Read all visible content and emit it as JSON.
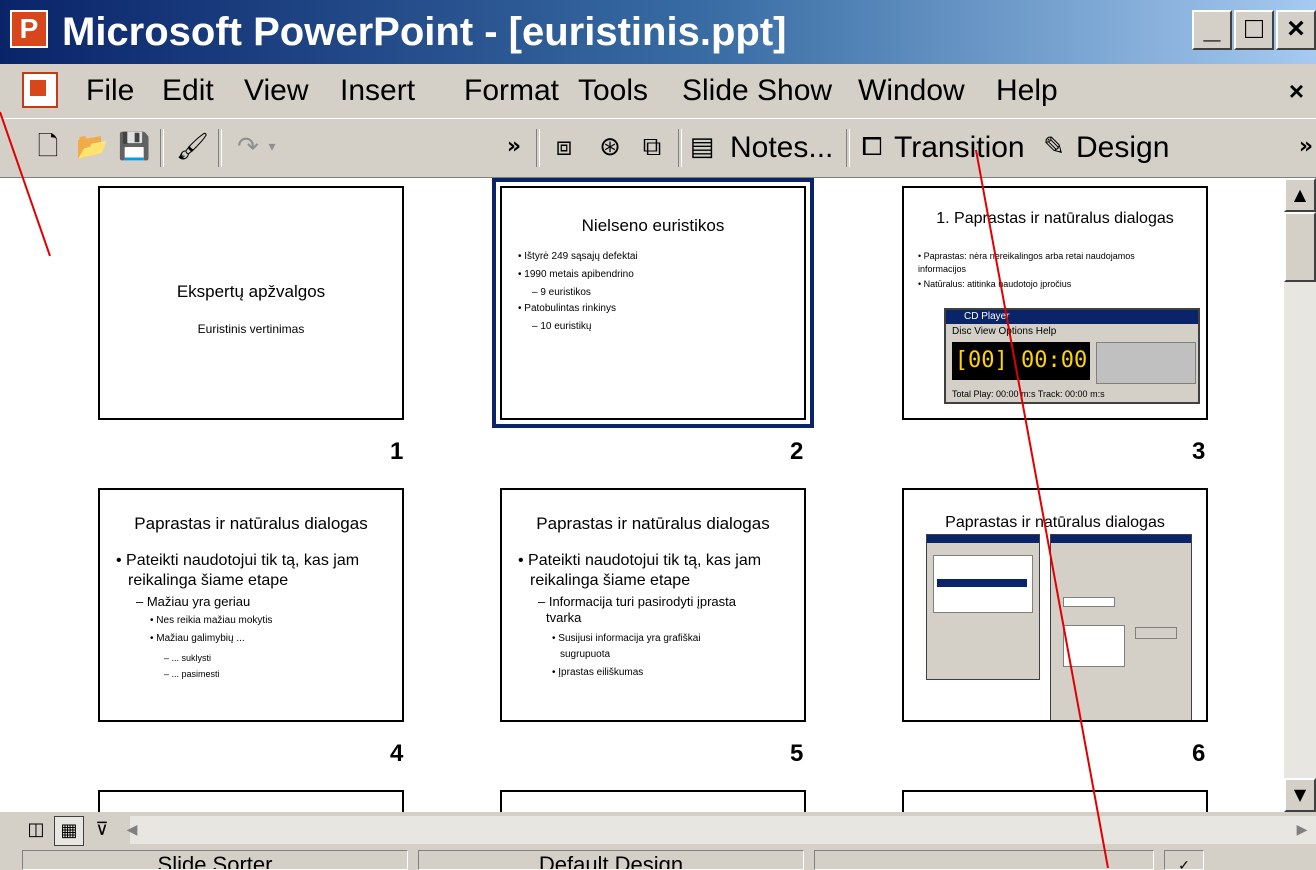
{
  "window": {
    "title": "Microsoft PowerPoint - [euristinis.ppt]",
    "minimize": "_",
    "maximize": "□",
    "close": "×"
  },
  "menu": {
    "items": [
      "File",
      "Edit",
      "View",
      "Insert",
      "Format",
      "Tools",
      "Slide Show",
      "Window",
      "Help"
    ],
    "close": "×"
  },
  "toolbar": {
    "notes_label": "Notes...",
    "transition_label": "Transition",
    "design_label": "Design",
    "chevron": "»"
  },
  "slides": [
    {
      "number": "1",
      "title": "Ekspertų apžvalgos",
      "subtitle": "Euristinis vertinimas"
    },
    {
      "number": "2",
      "title": "Nielseno euristikos",
      "bullets": [
        "Ištyrė 249 sąsajų defektai",
        "1990 metais apibendrino",
        "– 9 euristikos",
        "Patobulintas rinkinys",
        "– 10 euristikų"
      ]
    },
    {
      "number": "3",
      "title": "1. Paprastas ir natūralus dialogas",
      "bullets": [
        "Paprastas: nėra nereikalingos arba retai naudojamos informacijos",
        "Natūralus: atitinka naudotojo įpročius"
      ],
      "cd_player": {
        "title": "CD Player",
        "menu": "Disc  View  Options  Help",
        "display": "[00] 00:00",
        "status": "Total Play: 00:00 m:s       Track: 00:00 m:s"
      }
    },
    {
      "number": "4",
      "title": "Paprastas ir natūralus dialogas",
      "bullets": [
        "• Pateikti naudotojui tik tą, kas jam",
        "reikalinga šiame etape",
        "– Mažiau yra geriau",
        "• Nes reikia mažiau mokytis",
        "• Mažiau galimybių ...",
        "– ... suklysti",
        "– ... pasimesti"
      ]
    },
    {
      "number": "5",
      "title": "Paprastas ir natūralus dialogas",
      "bullets": [
        "• Pateikti naudotojui tik tą, kas jam",
        "reikalinga šiame etape",
        "– Informacija turi pasirodyti įprasta",
        "tvarka",
        "• Susijusi informacija yra grafiškai",
        "sugrupuota",
        "• Įprastas eiliškumas"
      ]
    },
    {
      "number": "6",
      "title": "Paprastas ir natūralus dialogas"
    }
  ],
  "statusbar": {
    "pane1": "Slide Sorter",
    "pane2": "Default Design"
  },
  "colors": {
    "titlebar": "#0a246a",
    "face": "#d4d0c8",
    "annotation": "#e00000"
  }
}
